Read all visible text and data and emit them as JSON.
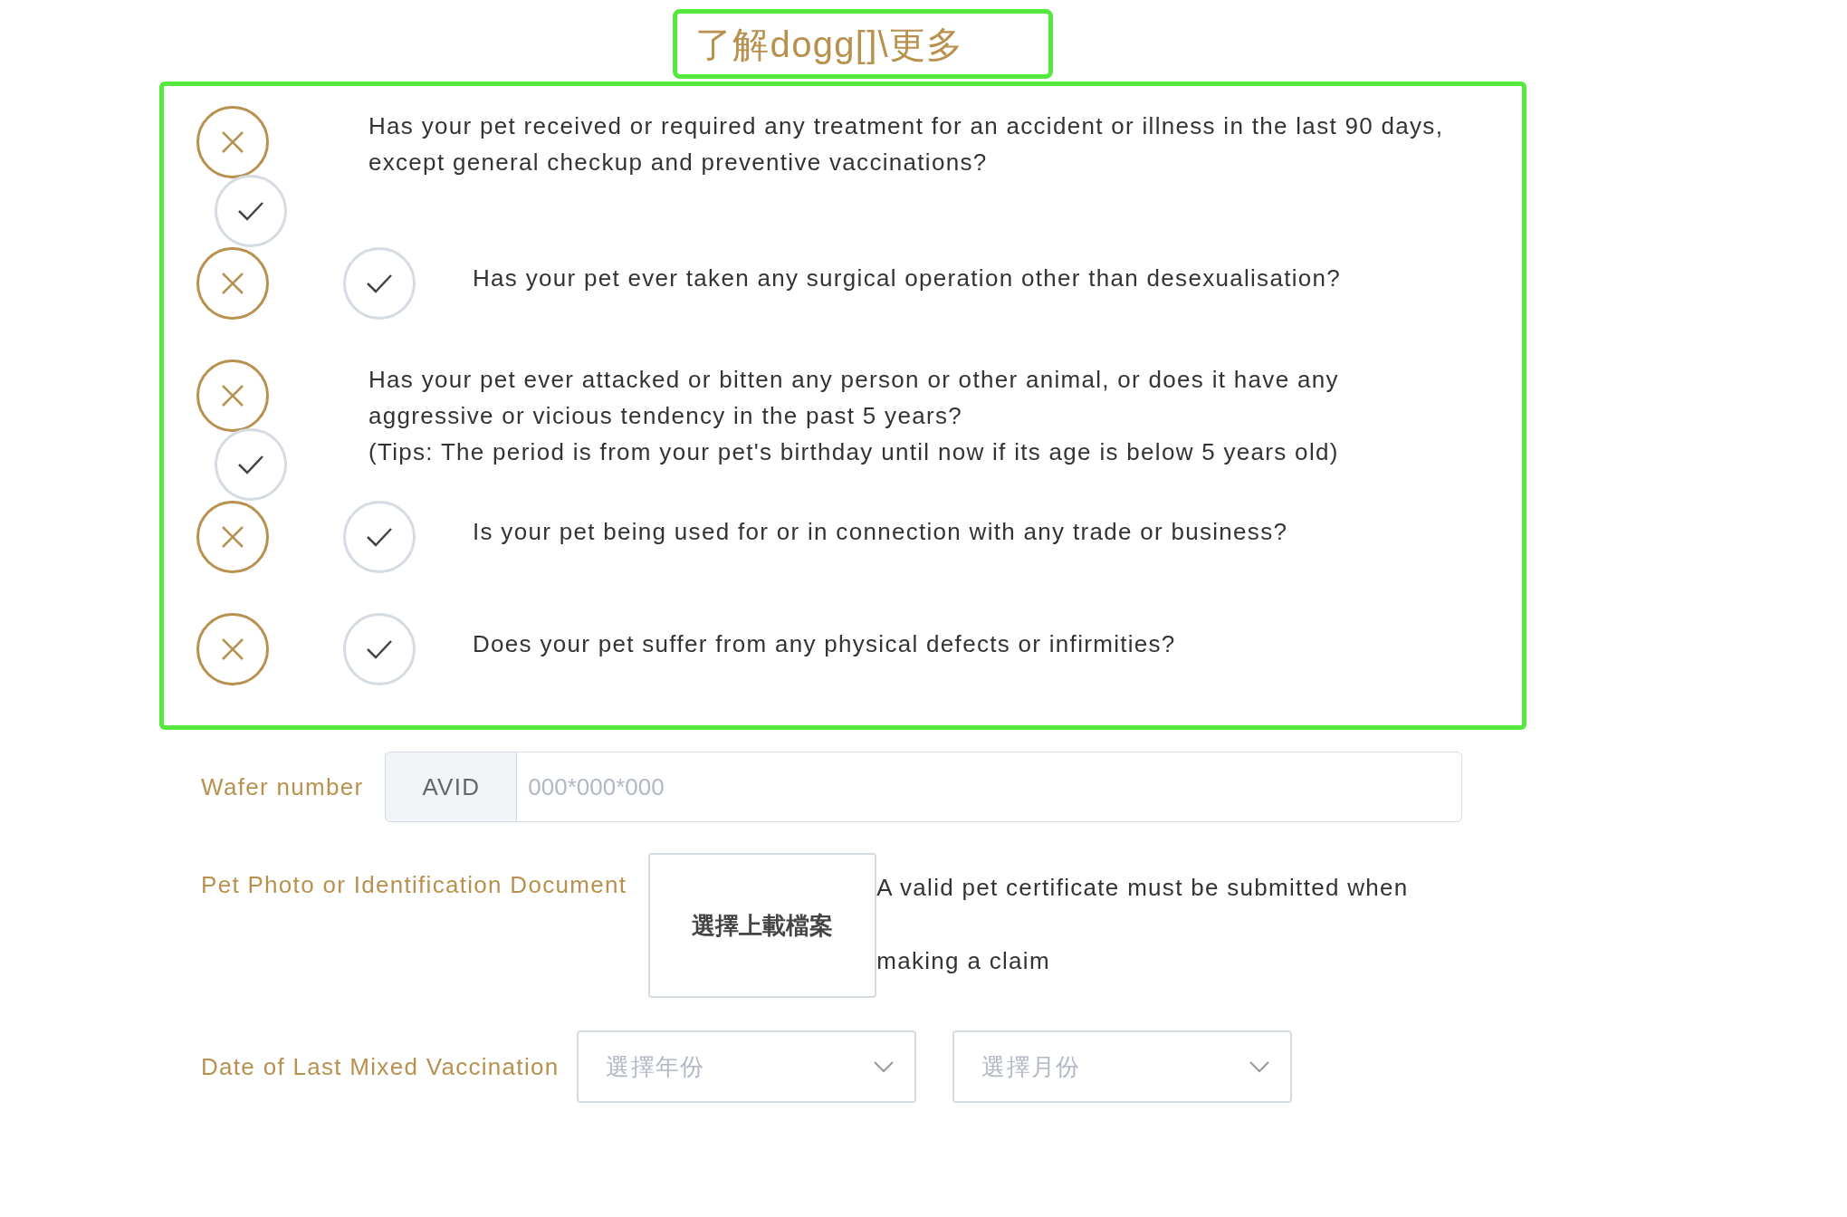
{
  "heading": "了解dogg[]\\更多",
  "questions": [
    {
      "kind": "stacked",
      "text": "Has your pet received or required any treatment for an accident or illness in the last 90 days, except general checkup and preventive vaccinations?",
      "options": [
        {
          "kind": "no",
          "selected": true
        },
        {
          "kind": "yes",
          "selected": false
        }
      ]
    },
    {
      "kind": "inline",
      "text": "Has your pet ever taken any surgical operation other than desexualisation?",
      "options": [
        {
          "kind": "no",
          "selected": true
        },
        {
          "kind": "yes",
          "selected": false
        }
      ]
    },
    {
      "kind": "stacked",
      "text": "Has your pet ever attacked or bitten any person or other animal, or does it have any aggressive or vicious tendency in the past 5 years?",
      "tip": "(Tips: The period is from your pet's birthday until now if its age is below 5 years old)",
      "options": [
        {
          "kind": "no",
          "selected": true
        },
        {
          "kind": "yes",
          "selected": false
        }
      ]
    },
    {
      "kind": "inline",
      "text": "Is your pet being used for or in connection with any trade or business?",
      "options": [
        {
          "kind": "no",
          "selected": true
        },
        {
          "kind": "yes",
          "selected": false
        }
      ]
    },
    {
      "kind": "inline",
      "text": "Does your pet suffer from any physical defects or infirmities?",
      "options": [
        {
          "kind": "no",
          "selected": true
        },
        {
          "kind": "yes",
          "selected": false
        }
      ]
    }
  ],
  "wafer": {
    "label": "Wafer number",
    "prefix": "AVID",
    "placeholder": "000*000*000"
  },
  "photo": {
    "label": "Pet Photo or Identification Document",
    "button": "選擇上載檔案",
    "note": "A valid pet certificate must be submitted when making a claim"
  },
  "vaccination": {
    "label": "Date of Last Mixed Vaccination",
    "selects": [
      {
        "placeholder": "選擇年份"
      },
      {
        "placeholder": "選擇月份"
      }
    ]
  }
}
